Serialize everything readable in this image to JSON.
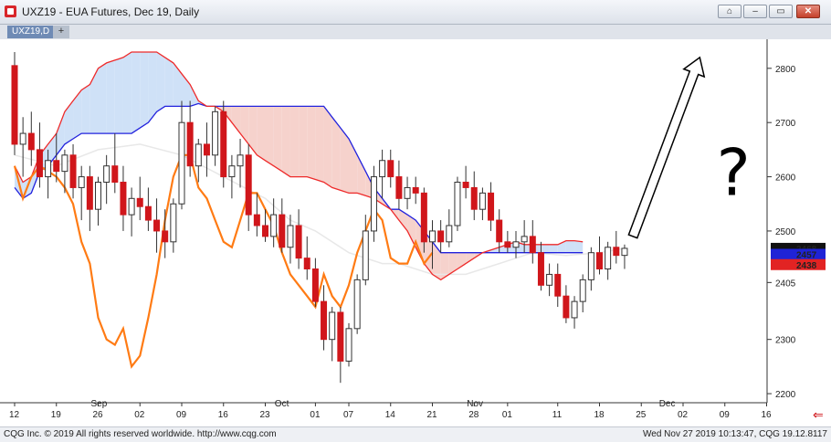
{
  "window": {
    "title": "UXZ19 - EUA Futures, Dec 19, Daily",
    "tab_label": "UXZ19,D",
    "tab_add": "+",
    "buttons": {
      "pin": "⌂",
      "minimize": "–",
      "maximize": "▭",
      "close": "✕"
    }
  },
  "footer": {
    "left": "CQG Inc. © 2019 All rights reserved worldwide. http://www.cqg.com",
    "right": "Wed Nov 27 2019 10:13:47, CQG 19.12.8117"
  },
  "colors": {
    "bull": "#ffffff",
    "bear": "#d0161b",
    "tenkan": "#ff7b14",
    "span_a": "#ee2a2a",
    "span_b": "#2222dd",
    "cloud_bull": "#cfe1f7",
    "cloud_bear": "#f6d2cc",
    "chikou": "#e8e8e8",
    "annotation_arrow": "#000000",
    "label_last": "#111111",
    "label_blue": "#1f23d6",
    "label_red": "#e22323"
  },
  "chart_data": {
    "type": "candlestick",
    "instrument": "UXZ19",
    "interval": "Daily",
    "y_ticks": [
      2800,
      2700,
      2600,
      2500,
      2405,
      2300,
      2200
    ],
    "ylim": [
      2190,
      2830
    ],
    "right_labels": [
      {
        "value": 2468,
        "text": "2468",
        "style": "last"
      },
      {
        "value": 2457,
        "text": "2457",
        "style": "blue"
      },
      {
        "value": 2438,
        "text": "2438",
        "style": "red"
      }
    ],
    "month_labels": [
      {
        "text": "Sep",
        "index": 10
      },
      {
        "text": "Oct",
        "index": 32
      },
      {
        "text": "Nov",
        "index": 55
      },
      {
        "text": "Dec",
        "index": 78
      }
    ],
    "day_labels": [
      {
        "text": "12",
        "index": 0
      },
      {
        "text": "19",
        "index": 5
      },
      {
        "text": "26",
        "index": 10
      },
      {
        "text": "02",
        "index": 15
      },
      {
        "text": "09",
        "index": 20
      },
      {
        "text": "16",
        "index": 25
      },
      {
        "text": "23",
        "index": 30
      },
      {
        "text": "01",
        "index": 36
      },
      {
        "text": "07",
        "index": 40
      },
      {
        "text": "14",
        "index": 45
      },
      {
        "text": "21",
        "index": 50
      },
      {
        "text": "28",
        "index": 55
      },
      {
        "text": "01",
        "index": 59
      },
      {
        "text": "11",
        "index": 65
      },
      {
        "text": "18",
        "index": 70
      },
      {
        "text": "25",
        "index": 75
      },
      {
        "text": "02",
        "index": 80
      },
      {
        "text": "09",
        "index": 85
      },
      {
        "text": "16",
        "index": 90
      }
    ],
    "candles": [
      [
        2805,
        2830,
        2640,
        2660
      ],
      [
        2660,
        2710,
        2600,
        2680
      ],
      [
        2680,
        2720,
        2620,
        2650
      ],
      [
        2650,
        2700,
        2580,
        2600
      ],
      [
        2600,
        2650,
        2560,
        2630
      ],
      [
        2630,
        2680,
        2590,
        2610
      ],
      [
        2610,
        2650,
        2570,
        2640
      ],
      [
        2640,
        2660,
        2560,
        2580
      ],
      [
        2580,
        2620,
        2520,
        2600
      ],
      [
        2600,
        2620,
        2500,
        2540
      ],
      [
        2540,
        2600,
        2510,
        2590
      ],
      [
        2590,
        2640,
        2550,
        2620
      ],
      [
        2620,
        2680,
        2570,
        2590
      ],
      [
        2590,
        2620,
        2500,
        2530
      ],
      [
        2530,
        2580,
        2490,
        2560
      ],
      [
        2560,
        2600,
        2520,
        2545
      ],
      [
        2545,
        2580,
        2500,
        2520
      ],
      [
        2520,
        2560,
        2460,
        2500
      ],
      [
        2500,
        2540,
        2450,
        2480
      ],
      [
        2480,
        2560,
        2460,
        2550
      ],
      [
        2550,
        2740,
        2540,
        2700
      ],
      [
        2700,
        2740,
        2600,
        2620
      ],
      [
        2620,
        2670,
        2590,
        2660
      ],
      [
        2660,
        2700,
        2600,
        2640
      ],
      [
        2640,
        2730,
        2620,
        2720
      ],
      [
        2720,
        2740,
        2580,
        2600
      ],
      [
        2600,
        2640,
        2560,
        2620
      ],
      [
        2620,
        2670,
        2580,
        2640
      ],
      [
        2640,
        2660,
        2500,
        2530
      ],
      [
        2530,
        2570,
        2490,
        2510
      ],
      [
        2510,
        2540,
        2480,
        2490
      ],
      [
        2490,
        2560,
        2470,
        2530
      ],
      [
        2530,
        2560,
        2460,
        2470
      ],
      [
        2470,
        2530,
        2440,
        2510
      ],
      [
        2510,
        2540,
        2430,
        2450
      ],
      [
        2450,
        2490,
        2410,
        2430
      ],
      [
        2430,
        2450,
        2360,
        2370
      ],
      [
        2370,
        2400,
        2280,
        2300
      ],
      [
        2300,
        2360,
        2260,
        2350
      ],
      [
        2350,
        2360,
        2220,
        2260
      ],
      [
        2260,
        2330,
        2250,
        2320
      ],
      [
        2320,
        2420,
        2310,
        2410
      ],
      [
        2410,
        2530,
        2400,
        2500
      ],
      [
        2500,
        2620,
        2480,
        2600
      ],
      [
        2600,
        2650,
        2560,
        2630
      ],
      [
        2630,
        2650,
        2580,
        2600
      ],
      [
        2600,
        2630,
        2540,
        2560
      ],
      [
        2560,
        2600,
        2540,
        2580
      ],
      [
        2580,
        2600,
        2550,
        2570
      ],
      [
        2570,
        2580,
        2460,
        2480
      ],
      [
        2480,
        2520,
        2430,
        2500
      ],
      [
        2500,
        2520,
        2460,
        2480
      ],
      [
        2480,
        2540,
        2470,
        2510
      ],
      [
        2510,
        2600,
        2500,
        2590
      ],
      [
        2590,
        2620,
        2560,
        2580
      ],
      [
        2580,
        2610,
        2520,
        2540
      ],
      [
        2540,
        2580,
        2520,
        2570
      ],
      [
        2570,
        2590,
        2500,
        2520
      ],
      [
        2520,
        2540,
        2460,
        2480
      ],
      [
        2480,
        2500,
        2460,
        2470
      ],
      [
        2470,
        2500,
        2450,
        2480
      ],
      [
        2480,
        2520,
        2460,
        2490
      ],
      [
        2490,
        2520,
        2440,
        2460
      ],
      [
        2460,
        2480,
        2390,
        2400
      ],
      [
        2400,
        2440,
        2380,
        2420
      ],
      [
        2420,
        2440,
        2360,
        2380
      ],
      [
        2380,
        2400,
        2330,
        2340
      ],
      [
        2340,
        2380,
        2320,
        2370
      ],
      [
        2370,
        2420,
        2350,
        2410
      ],
      [
        2410,
        2470,
        2390,
        2460
      ],
      [
        2460,
        2490,
        2420,
        2430
      ],
      [
        2430,
        2480,
        2410,
        2470
      ],
      [
        2470,
        2500,
        2440,
        2455
      ],
      [
        2455,
        2475,
        2430,
        2468
      ]
    ],
    "candle_start_index": 0,
    "tenkan": [
      [
        0,
        2620
      ],
      [
        1,
        2560
      ],
      [
        2,
        2600
      ],
      [
        3,
        2620
      ],
      [
        4,
        2610
      ],
      [
        5,
        2600
      ],
      [
        6,
        2580
      ],
      [
        7,
        2550
      ],
      [
        8,
        2480
      ],
      [
        9,
        2440
      ],
      [
        10,
        2340
      ],
      [
        11,
        2300
      ],
      [
        12,
        2290
      ],
      [
        13,
        2320
      ],
      [
        14,
        2250
      ],
      [
        15,
        2270
      ],
      [
        16,
        2340
      ],
      [
        17,
        2420
      ],
      [
        18,
        2520
      ],
      [
        19,
        2600
      ],
      [
        20,
        2640
      ],
      [
        21,
        2640
      ],
      [
        22,
        2580
      ],
      [
        23,
        2560
      ],
      [
        24,
        2520
      ],
      [
        25,
        2480
      ],
      [
        26,
        2470
      ],
      [
        27,
        2520
      ],
      [
        28,
        2570
      ],
      [
        29,
        2570
      ],
      [
        30,
        2540
      ],
      [
        31,
        2510
      ],
      [
        32,
        2460
      ],
      [
        33,
        2420
      ],
      [
        34,
        2400
      ],
      [
        35,
        2380
      ],
      [
        36,
        2360
      ],
      [
        37,
        2420
      ],
      [
        38,
        2380
      ],
      [
        39,
        2360
      ],
      [
        40,
        2400
      ],
      [
        41,
        2460
      ],
      [
        42,
        2500
      ],
      [
        43,
        2540
      ],
      [
        44,
        2520
      ],
      [
        45,
        2450
      ],
      [
        46,
        2440
      ],
      [
        47,
        2440
      ],
      [
        48,
        2480
      ],
      [
        49,
        2440
      ],
      [
        50,
        2460
      ]
    ],
    "span_a": [
      [
        0,
        2620
      ],
      [
        1,
        2590
      ],
      [
        2,
        2600
      ],
      [
        3,
        2640
      ],
      [
        4,
        2660
      ],
      [
        5,
        2680
      ],
      [
        6,
        2720
      ],
      [
        7,
        2740
      ],
      [
        8,
        2760
      ],
      [
        9,
        2770
      ],
      [
        10,
        2800
      ],
      [
        11,
        2810
      ],
      [
        12,
        2815
      ],
      [
        13,
        2820
      ],
      [
        14,
        2830
      ],
      [
        15,
        2830
      ],
      [
        16,
        2830
      ],
      [
        17,
        2830
      ],
      [
        18,
        2820
      ],
      [
        19,
        2810
      ],
      [
        20,
        2790
      ],
      [
        21,
        2770
      ],
      [
        22,
        2740
      ],
      [
        23,
        2730
      ],
      [
        24,
        2730
      ],
      [
        25,
        2720
      ],
      [
        26,
        2700
      ],
      [
        27,
        2680
      ],
      [
        28,
        2660
      ],
      [
        29,
        2640
      ],
      [
        30,
        2630
      ],
      [
        31,
        2620
      ],
      [
        32,
        2610
      ],
      [
        33,
        2600
      ],
      [
        34,
        2600
      ],
      [
        35,
        2600
      ],
      [
        36,
        2595
      ],
      [
        37,
        2590
      ],
      [
        38,
        2580
      ],
      [
        39,
        2575
      ],
      [
        40,
        2570
      ],
      [
        41,
        2570
      ],
      [
        42,
        2565
      ],
      [
        43,
        2560
      ],
      [
        44,
        2550
      ],
      [
        45,
        2540
      ],
      [
        46,
        2520
      ],
      [
        47,
        2500
      ],
      [
        48,
        2470
      ],
      [
        49,
        2440
      ],
      [
        50,
        2420
      ],
      [
        51,
        2410
      ],
      [
        52,
        2420
      ],
      [
        53,
        2430
      ],
      [
        54,
        2440
      ],
      [
        55,
        2450
      ],
      [
        56,
        2460
      ],
      [
        57,
        2465
      ],
      [
        58,
        2470
      ],
      [
        59,
        2475
      ],
      [
        60,
        2480
      ],
      [
        61,
        2475
      ],
      [
        62,
        2475
      ],
      [
        63,
        2475
      ],
      [
        64,
        2475
      ],
      [
        65,
        2475
      ],
      [
        66,
        2482
      ],
      [
        67,
        2482
      ],
      [
        68,
        2480
      ]
    ],
    "span_b": [
      [
        0,
        2580
      ],
      [
        1,
        2560
      ],
      [
        2,
        2570
      ],
      [
        3,
        2610
      ],
      [
        4,
        2620
      ],
      [
        5,
        2640
      ],
      [
        6,
        2660
      ],
      [
        7,
        2670
      ],
      [
        8,
        2680
      ],
      [
        9,
        2680
      ],
      [
        10,
        2680
      ],
      [
        11,
        2680
      ],
      [
        12,
        2680
      ],
      [
        13,
        2680
      ],
      [
        14,
        2680
      ],
      [
        15,
        2690
      ],
      [
        16,
        2700
      ],
      [
        17,
        2720
      ],
      [
        18,
        2730
      ],
      [
        19,
        2730
      ],
      [
        20,
        2730
      ],
      [
        21,
        2730
      ],
      [
        22,
        2735
      ],
      [
        23,
        2730
      ],
      [
        24,
        2730
      ],
      [
        25,
        2730
      ],
      [
        26,
        2730
      ],
      [
        27,
        2730
      ],
      [
        28,
        2730
      ],
      [
        29,
        2730
      ],
      [
        30,
        2730
      ],
      [
        31,
        2730
      ],
      [
        32,
        2730
      ],
      [
        33,
        2730
      ],
      [
        34,
        2730
      ],
      [
        35,
        2730
      ],
      [
        36,
        2730
      ],
      [
        37,
        2730
      ],
      [
        38,
        2710
      ],
      [
        39,
        2690
      ],
      [
        40,
        2670
      ],
      [
        41,
        2640
      ],
      [
        42,
        2610
      ],
      [
        43,
        2580
      ],
      [
        44,
        2560
      ],
      [
        45,
        2540
      ],
      [
        46,
        2540
      ],
      [
        47,
        2530
      ],
      [
        48,
        2520
      ],
      [
        49,
        2500
      ],
      [
        50,
        2480
      ],
      [
        51,
        2460
      ],
      [
        52,
        2460
      ],
      [
        53,
        2460
      ],
      [
        54,
        2460
      ],
      [
        55,
        2460
      ],
      [
        56,
        2460
      ],
      [
        57,
        2460
      ],
      [
        58,
        2460
      ],
      [
        59,
        2460
      ],
      [
        60,
        2460
      ],
      [
        61,
        2460
      ],
      [
        62,
        2460
      ],
      [
        63,
        2460
      ],
      [
        64,
        2460
      ],
      [
        65,
        2460
      ],
      [
        66,
        2460
      ],
      [
        67,
        2460
      ],
      [
        68,
        2460
      ]
    ],
    "chikou": [
      [
        0,
        2640
      ],
      [
        5,
        2620
      ],
      [
        10,
        2650
      ],
      [
        15,
        2660
      ],
      [
        20,
        2640
      ],
      [
        25,
        2600
      ],
      [
        30,
        2560
      ],
      [
        33,
        2520
      ],
      [
        36,
        2500
      ],
      [
        40,
        2460
      ],
      [
        44,
        2440
      ],
      [
        46,
        2440
      ],
      [
        50,
        2420
      ],
      [
        54,
        2420
      ],
      [
        58,
        2440
      ],
      [
        62,
        2460
      ],
      [
        66,
        2455
      ],
      [
        70,
        2460
      ],
      [
        73,
        2468
      ]
    ],
    "annotations": [
      {
        "type": "arrow",
        "from": [
          74,
          2490
        ],
        "to": [
          82,
          2820
        ]
      },
      {
        "type": "text",
        "text": "?",
        "at": [
          84,
          2600
        ]
      }
    ]
  }
}
